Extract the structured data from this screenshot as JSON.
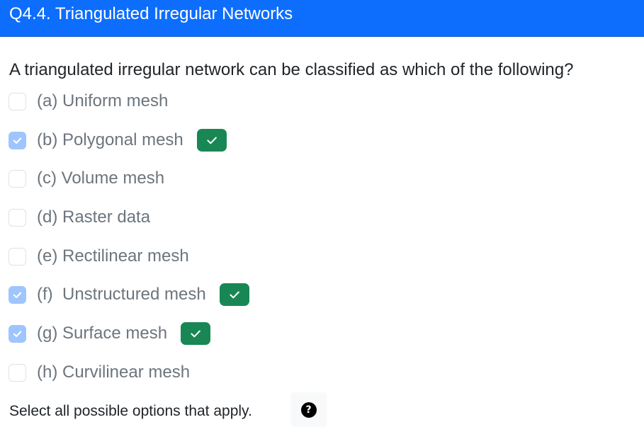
{
  "header": {
    "title": "Q4.4. Triangulated Irregular Networks",
    "background_color": "#0d6efd"
  },
  "question": {
    "text": "A triangulated irregular network can be classified as which of the following?"
  },
  "options": [
    {
      "label": "(a) Uniform mesh",
      "checked": false,
      "marked_correct": false
    },
    {
      "label": "(b) Polygonal mesh",
      "checked": true,
      "marked_correct": true
    },
    {
      "label": "(c) Volume mesh",
      "checked": false,
      "marked_correct": false
    },
    {
      "label": "(d) Raster data",
      "checked": false,
      "marked_correct": false
    },
    {
      "label": "(e) Rectilinear mesh",
      "checked": false,
      "marked_correct": false
    },
    {
      "label": "(f)  Unstructured mesh",
      "checked": true,
      "marked_correct": true
    },
    {
      "label": "(g) Surface mesh",
      "checked": true,
      "marked_correct": true
    },
    {
      "label": "(h) Curvilinear mesh",
      "checked": false,
      "marked_correct": false
    }
  ],
  "footer": {
    "instruction": "Select all possible options that apply.",
    "help_icon": "question-circle-icon",
    "help_symbol": "?"
  },
  "colors": {
    "checked_box": "#9ec5fe",
    "correct_badge": "#198754",
    "option_text": "#6c757d"
  }
}
